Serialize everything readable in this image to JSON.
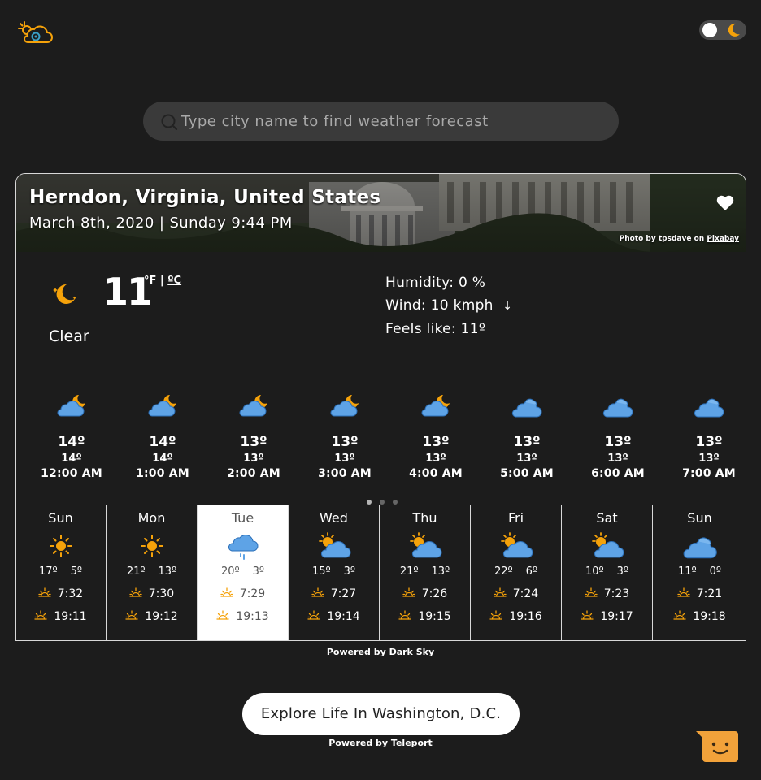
{
  "app": {
    "logo_icon": "weather-cloud-logo-icon",
    "theme_toggle_icon": "moon-icon"
  },
  "search": {
    "placeholder": "Type city name to find weather forecast",
    "value": ""
  },
  "location": {
    "name": "Herndon, Virginia, United States",
    "datetime": "March 8th, 2020 | Sunday 9:44 PM",
    "photo_credit_prefix": "Photo by tpsdave on",
    "photo_credit_link": "Pixabay",
    "favorite_icon": "heart-icon"
  },
  "current": {
    "icon": "crescent-moon-icon",
    "temp": "11",
    "unit_f": "°F",
    "unit_sep": " | ",
    "unit_c": "ºC",
    "condition": "Clear",
    "humidity": "Humidity:  0 %",
    "wind_label": "Wind: 10 kmph",
    "wind_arrow": "↓",
    "feels_like": "Feels like: 11º"
  },
  "hourly": [
    {
      "icon": "cloud-moon-icon",
      "temp": "14º",
      "feels": "14º",
      "time": "12:00 AM"
    },
    {
      "icon": "cloud-moon-icon",
      "temp": "14º",
      "feels": "14º",
      "time": "1:00 AM"
    },
    {
      "icon": "cloud-moon-icon",
      "temp": "13º",
      "feels": "13º",
      "time": "2:00 AM"
    },
    {
      "icon": "cloud-moon-icon",
      "temp": "13º",
      "feels": "13º",
      "time": "3:00 AM"
    },
    {
      "icon": "cloud-moon-icon",
      "temp": "13º",
      "feels": "13º",
      "time": "4:00 AM"
    },
    {
      "icon": "cloud-icon",
      "temp": "13º",
      "feels": "13º",
      "time": "5:00 AM"
    },
    {
      "icon": "cloud-icon",
      "temp": "13º",
      "feels": "13º",
      "time": "6:00 AM"
    },
    {
      "icon": "cloud-icon",
      "temp": "13º",
      "feels": "13º",
      "time": "7:00 AM"
    }
  ],
  "pager": {
    "count": 3,
    "active": 0
  },
  "daily": [
    {
      "day": "Sun",
      "icon": "sun-icon",
      "high": "17º",
      "low": "5º",
      "sunrise": "7:32",
      "sunset": "19:11",
      "selected": false
    },
    {
      "day": "Mon",
      "icon": "sun-icon",
      "high": "21º",
      "low": "13º",
      "sunrise": "7:30",
      "sunset": "19:12",
      "selected": false
    },
    {
      "day": "Tue",
      "icon": "rain-cloud-icon",
      "high": "20º",
      "low": "3º",
      "sunrise": "7:29",
      "sunset": "19:13",
      "selected": true
    },
    {
      "day": "Wed",
      "icon": "partly-cloudy-icon",
      "high": "15º",
      "low": "3º",
      "sunrise": "7:27",
      "sunset": "19:14",
      "selected": false
    },
    {
      "day": "Thu",
      "icon": "partly-cloudy-icon",
      "high": "21º",
      "low": "13º",
      "sunrise": "7:26",
      "sunset": "19:15",
      "selected": false
    },
    {
      "day": "Fri",
      "icon": "partly-cloudy-icon",
      "high": "22º",
      "low": "6º",
      "sunrise": "7:24",
      "sunset": "19:16",
      "selected": false
    },
    {
      "day": "Sat",
      "icon": "partly-cloudy-icon",
      "high": "10º",
      "low": "3º",
      "sunrise": "7:23",
      "sunset": "19:17",
      "selected": false
    },
    {
      "day": "Sun",
      "icon": "cloud-icon",
      "high": "11º",
      "low": "0º",
      "sunrise": "7:21",
      "sunset": "19:18",
      "selected": false
    }
  ],
  "footer": {
    "powered1_prefix": "Powered by",
    "powered1_link": "Dark Sky",
    "explore_label": "Explore Life In Washington, D.C.",
    "powered2_prefix": "Powered by",
    "powered2_link": "Teleport",
    "chat_icon": "chat-smiley-icon"
  },
  "colors": {
    "background": "#1c1c1c",
    "sun": "#f5a20a",
    "cloud": "#5ea3e6",
    "selected_bg": "#ffffff"
  }
}
